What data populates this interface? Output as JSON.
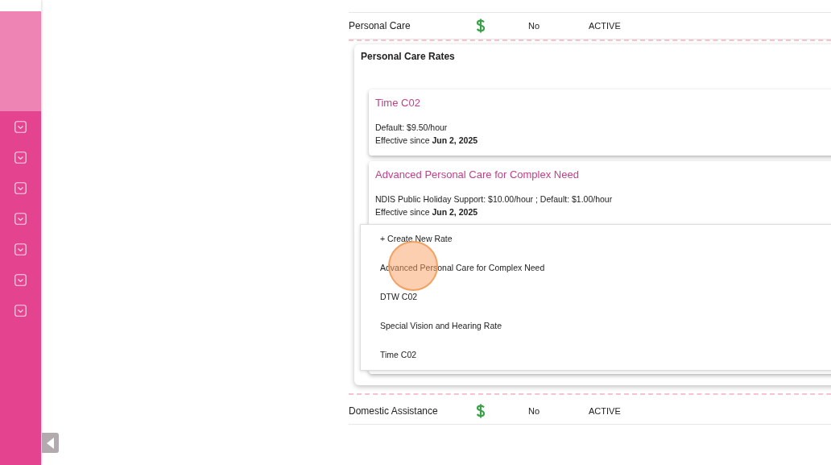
{
  "services": [
    {
      "name": "Personal Care",
      "billable": true,
      "column_3": "No",
      "status": "ACTIVE",
      "rates_panel": {
        "title": "Personal Care Rates",
        "rates": [
          {
            "title": "Time C02",
            "rate_line": "Default: $9.50/hour",
            "effective_label": "Effective since",
            "effective_date": "Jun 2, 2025"
          },
          {
            "title": "Advanced Personal Care for Complex Need",
            "rate_line": "NDIS Public Holiday Support: $10.00/hour ; Default: $1.00/hour",
            "effective_label": "Effective since",
            "effective_date": "Jun 2, 2025"
          }
        ],
        "dropdown": {
          "open": true,
          "items": [
            "+ Create New Rate",
            "Advanced Personal Care for Complex Need",
            "DTW C02",
            "Special Vision and Hearing Rate",
            "Time C02"
          ]
        }
      }
    },
    {
      "name": "Domestic Assistance",
      "billable": true,
      "column_3": "No",
      "status": "ACTIVE"
    }
  ],
  "click_marker": {
    "shown": true
  }
}
